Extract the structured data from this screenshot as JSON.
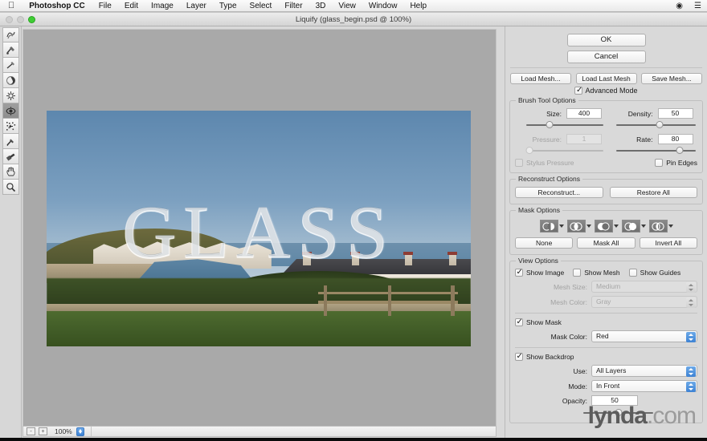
{
  "menubar": {
    "apple_icon": "apple-icon",
    "app_name": "Photoshop CC",
    "items": [
      "File",
      "Edit",
      "Image",
      "Layer",
      "Type",
      "Select",
      "Filter",
      "3D",
      "View",
      "Window",
      "Help"
    ],
    "right_icons": [
      "creative-cloud-icon",
      "list-icon"
    ]
  },
  "window": {
    "title": "Liquify (glass_begin.psd @ 100%)",
    "traffic_lights": [
      "close-button",
      "minimize-button",
      "maximize-button"
    ]
  },
  "tools": [
    {
      "name": "forward-warp-tool",
      "selected": false
    },
    {
      "name": "reconstruct-tool",
      "selected": false
    },
    {
      "name": "smooth-tool",
      "selected": false
    },
    {
      "name": "twirl-clockwise-tool",
      "selected": false
    },
    {
      "name": "pucker-tool",
      "selected": false
    },
    {
      "name": "bloat-tool",
      "selected": true
    },
    {
      "name": "push-left-tool",
      "selected": false
    },
    {
      "name": "freeze-mask-tool",
      "selected": false
    },
    {
      "name": "thaw-mask-tool",
      "selected": false
    },
    {
      "name": "hand-tool",
      "selected": false
    },
    {
      "name": "zoom-tool",
      "selected": false
    }
  ],
  "canvas": {
    "overlay_text": "GLASS",
    "zoom_level": "100%",
    "zoom_out_label": "-",
    "zoom_in_label": "+"
  },
  "panel": {
    "ok_label": "OK",
    "cancel_label": "Cancel",
    "load_mesh_label": "Load Mesh...",
    "load_last_mesh_label": "Load Last Mesh",
    "save_mesh_label": "Save Mesh...",
    "advanced_mode_label": "Advanced Mode",
    "advanced_mode_checked": true,
    "brush_tool_options": {
      "legend": "Brush Tool Options",
      "size_label": "Size:",
      "size_value": "400",
      "size_pct": 30,
      "density_label": "Density:",
      "density_value": "50",
      "density_pct": 55,
      "pressure_label": "Pressure:",
      "pressure_value": "1",
      "pressure_pct": 4,
      "rate_label": "Rate:",
      "rate_value": "80",
      "rate_pct": 80,
      "stylus_pressure_label": "Stylus Pressure",
      "stylus_pressure_checked": false,
      "pin_edges_label": "Pin Edges",
      "pin_edges_checked": false
    },
    "reconstruct_options": {
      "legend": "Reconstruct Options",
      "reconstruct_label": "Reconstruct...",
      "restore_all_label": "Restore All"
    },
    "mask_options": {
      "legend": "Mask Options",
      "icons": [
        "mask-replace-selection-icon",
        "mask-add-to-selection-icon",
        "mask-subtract-from-selection-icon",
        "mask-intersect-with-selection-icon",
        "mask-invert-selection-icon"
      ],
      "none_label": "None",
      "mask_all_label": "Mask All",
      "invert_all_label": "Invert All"
    },
    "view_options": {
      "legend": "View Options",
      "show_image_label": "Show Image",
      "show_image_checked": true,
      "show_mesh_label": "Show Mesh",
      "show_mesh_checked": false,
      "show_guides_label": "Show Guides",
      "show_guides_checked": false,
      "mesh_size_label": "Mesh Size:",
      "mesh_size_value": "Medium",
      "mesh_color_label": "Mesh Color:",
      "mesh_color_value": "Gray",
      "show_mask_label": "Show Mask",
      "show_mask_checked": true,
      "mask_color_label": "Mask Color:",
      "mask_color_value": "Red",
      "show_backdrop_label": "Show Backdrop",
      "show_backdrop_checked": true,
      "use_label": "Use:",
      "use_value": "All Layers",
      "mode_label": "Mode:",
      "mode_value": "In Front",
      "opacity_label": "Opacity:",
      "opacity_value": "50",
      "opacity_pct": 50
    }
  },
  "watermark": {
    "bold": "lynda",
    "light": ".com"
  },
  "colors": {
    "accent_blue": "#3d82d4",
    "panel_bg": "#d9d9d9",
    "canvas_bg": "#a9a9a9",
    "maximize_green": "#3fcd35"
  }
}
